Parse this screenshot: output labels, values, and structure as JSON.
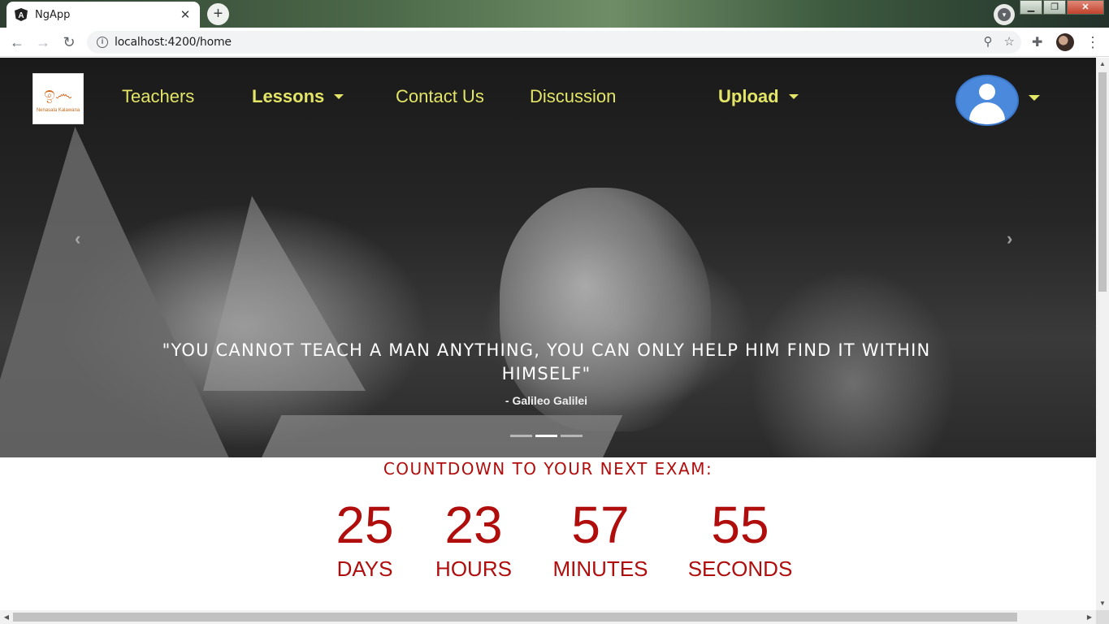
{
  "browser": {
    "tab_title": "NgApp",
    "url": "localhost:4200/home",
    "new_tab_label": "+",
    "close_tab_label": "✕"
  },
  "site": {
    "logo_text": "Nenasala Kalawana",
    "nav": {
      "teachers": "Teachers",
      "lessons": "Lessons",
      "contact": "Contact Us",
      "discussion": "Discussion",
      "upload": "Upload"
    }
  },
  "carousel": {
    "quote": "\"YOU CANNOT TEACH A MAN ANYTHING, YOU CAN ONLY HELP HIM FIND IT WITHIN HIMSELF\"",
    "author": "- Galileo Galilei",
    "slide_count": 3,
    "active_slide": 2
  },
  "countdown": {
    "title": "COUNTDOWN TO YOUR NEXT EXAM:",
    "units": [
      {
        "value": "25",
        "label": "DAYS"
      },
      {
        "value": "23",
        "label": "HOURS"
      },
      {
        "value": "57",
        "label": "MINUTES"
      },
      {
        "value": "55",
        "label": "SECONDS"
      }
    ]
  },
  "colors": {
    "nav_link": "#e3e567",
    "countdown": "#b00d0d",
    "avatar_bg": "#4a89dc"
  },
  "icons": [
    "angular-favicon",
    "close-icon",
    "plus-icon",
    "tab-search-icon",
    "back-arrow-icon",
    "forward-arrow-icon",
    "reload-icon",
    "info-icon",
    "zoom-icon",
    "star-icon",
    "puzzle-extension-icon",
    "profile-avatar",
    "more-vert-icon",
    "user-avatar-icon",
    "chevron-left-icon",
    "chevron-right-icon"
  ]
}
